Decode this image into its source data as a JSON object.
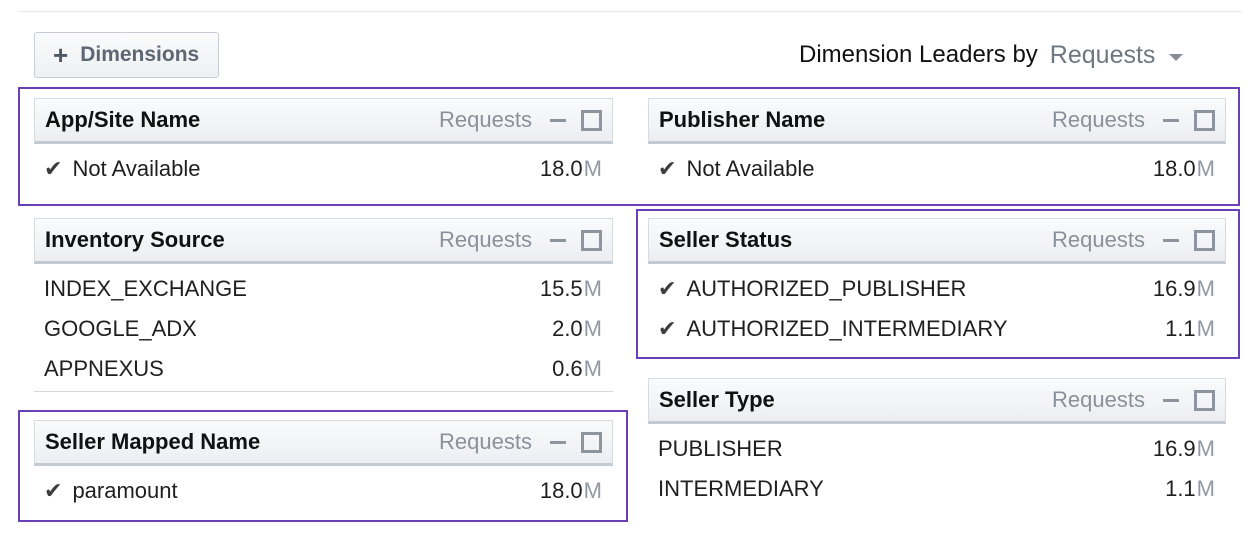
{
  "toolbar": {
    "dimensions_button": "Dimensions",
    "plus_icon": "+",
    "leaders_label": "Dimension Leaders by",
    "leaders_metric": "Requests"
  },
  "colors": {
    "selection_outline": "#6b3fb8",
    "unit": "#9199a3"
  },
  "panels": [
    {
      "title": "App/Site Name",
      "metric": "Requests",
      "rows": [
        {
          "check": "✔",
          "name": "Not Available",
          "value": "18.0",
          "unit": "M"
        }
      ]
    },
    {
      "title": "Publisher Name",
      "metric": "Requests",
      "rows": [
        {
          "check": "✔",
          "name": "Not Available",
          "value": "18.0",
          "unit": "M"
        }
      ]
    },
    {
      "title": "Inventory Source",
      "metric": "Requests",
      "rows": [
        {
          "name": "INDEX_EXCHANGE",
          "value": "15.5",
          "unit": "M"
        },
        {
          "name": "GOOGLE_ADX",
          "value": "2.0",
          "unit": "M"
        },
        {
          "name": "APPNEXUS",
          "value": "0.6",
          "unit": "M"
        }
      ]
    },
    {
      "title": "Seller Status",
      "metric": "Requests",
      "rows": [
        {
          "check": "✔",
          "name": "AUTHORIZED_PUBLISHER",
          "value": "16.9",
          "unit": "M"
        },
        {
          "check": "✔",
          "name": "AUTHORIZED_INTERMEDIARY",
          "value": "1.1",
          "unit": "M"
        }
      ]
    },
    {
      "title": "Seller Type",
      "metric": "Requests",
      "rows": [
        {
          "name": "PUBLISHER",
          "value": "16.9",
          "unit": "M"
        },
        {
          "name": "INTERMEDIARY",
          "value": "1.1",
          "unit": "M"
        }
      ]
    },
    {
      "title": "Seller Mapped Name",
      "metric": "Requests",
      "rows": [
        {
          "check": "✔",
          "name": "paramount",
          "value": "18.0",
          "unit": "M"
        }
      ]
    }
  ]
}
